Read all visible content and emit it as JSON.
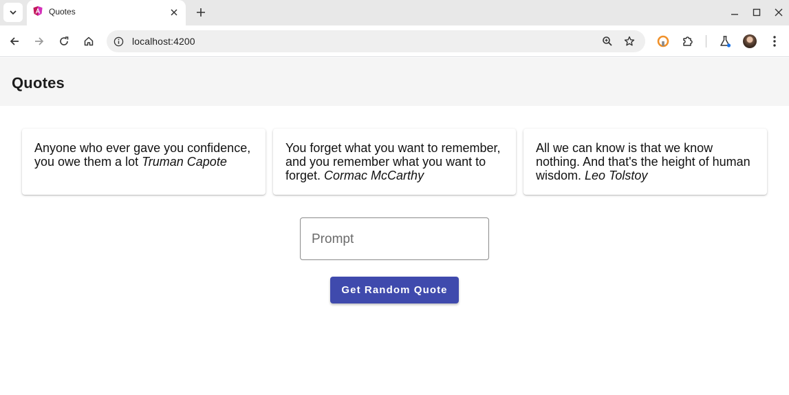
{
  "browser": {
    "tab_title": "Quotes",
    "url": "localhost:4200",
    "icons": [
      "tab-search-icon",
      "angular-favicon",
      "close-icon",
      "plus-icon",
      "minimize-icon",
      "maximize-icon",
      "window-close-icon",
      "back-arrow-icon",
      "forward-arrow-icon",
      "reload-icon",
      "home-icon",
      "info-icon",
      "zoom-icon",
      "star-icon",
      "extension-orange-icon",
      "puzzle-icon",
      "labs-flask-icon",
      "avatar",
      "kebab-menu-icon"
    ]
  },
  "app": {
    "title": "Quotes",
    "quotes": [
      {
        "text": "Anyone who ever gave you confidence, you owe them a lot",
        "author": "Truman Capote"
      },
      {
        "text": "You forget what you want to remember, and you remember what you want to forget.",
        "author": "Cormac McCarthy"
      },
      {
        "text": "All we can know is that we know nothing. And that's the height of human wisdom.",
        "author": "Leo Tolstoy"
      }
    ],
    "prompt": {
      "placeholder": "Prompt",
      "value": ""
    },
    "button_label": "Get Random Quote"
  },
  "colors": {
    "accent": "#3f4aad",
    "header_bg": "#f5f5f5",
    "tabstrip_bg": "#e8e8e8"
  }
}
